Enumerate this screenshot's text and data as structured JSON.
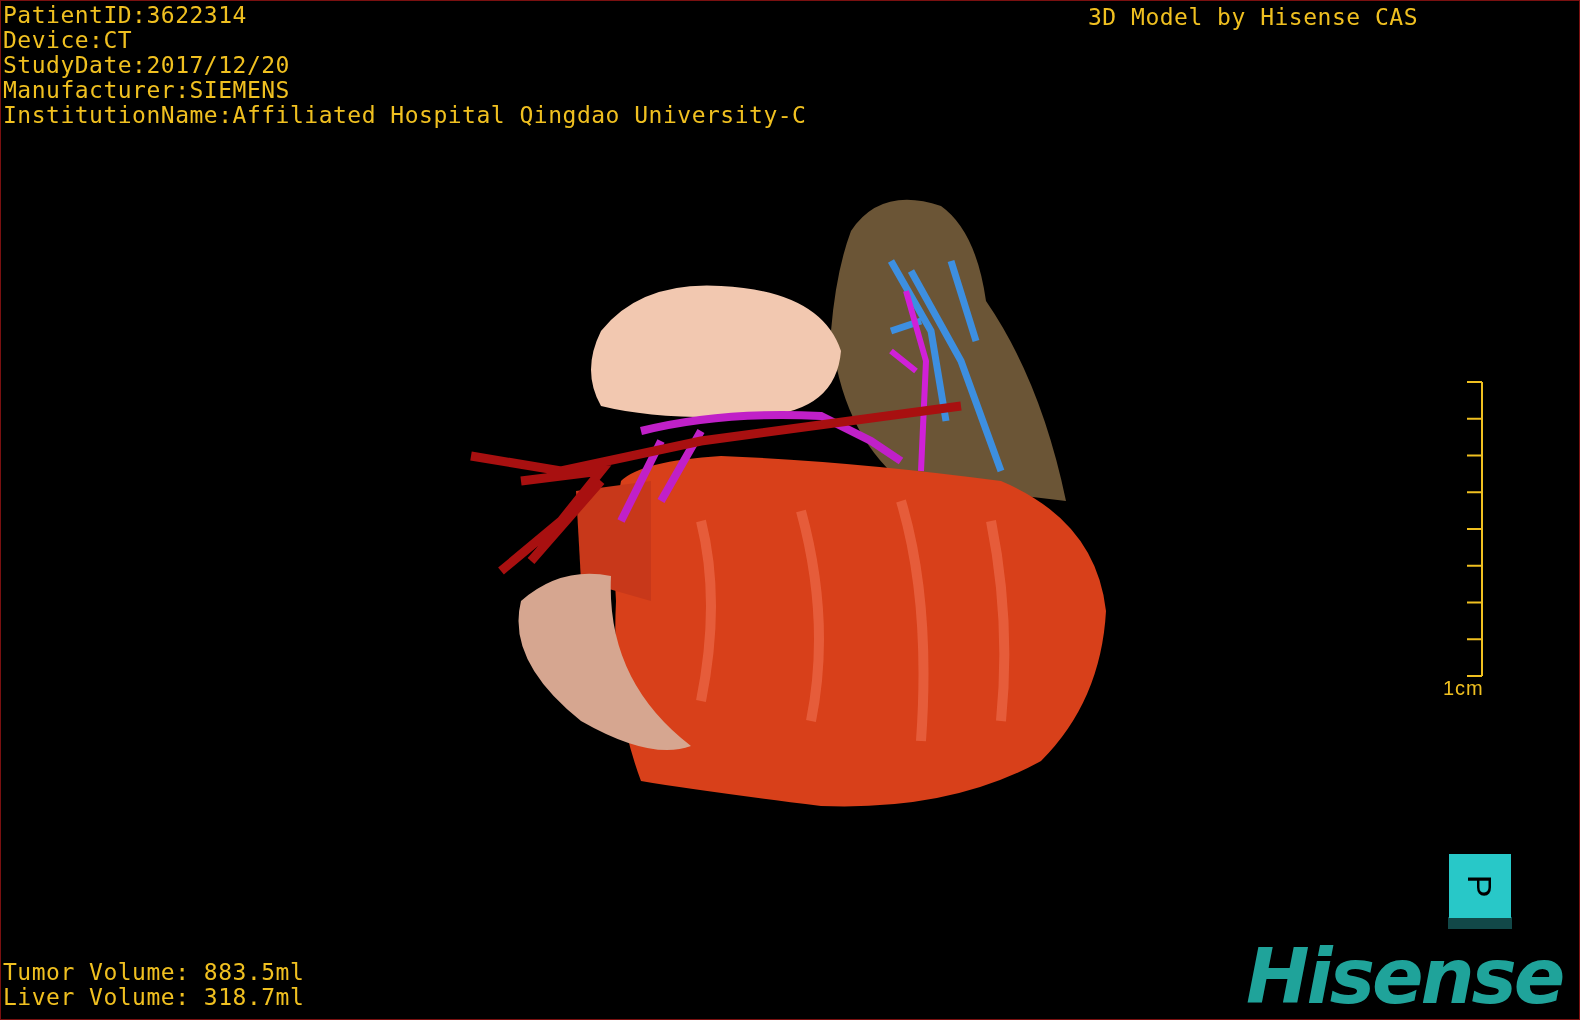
{
  "patient_info": [
    "PatientID:3622314",
    "Device:CT",
    "StudyDate:2017/12/20",
    "Manufacturer:SIEMENS",
    "InstitutionName:Affiliated Hospital Qingdao University-C"
  ],
  "model_caption": "3D Model by Hisense CAS",
  "scale_bar": {
    "label": "1cm"
  },
  "orientation_cube": {
    "label": "P"
  },
  "volumes": [
    "Tumor Volume: 883.5ml",
    "Liver Volume: 318.7ml"
  ],
  "logo": "Hisense"
}
